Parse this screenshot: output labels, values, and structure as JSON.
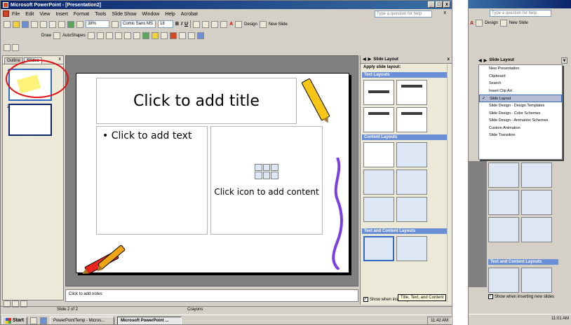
{
  "window": {
    "title": "Microsoft PowerPoint - [Presentation2]",
    "controls": [
      "_",
      "□",
      "x"
    ]
  },
  "menu": {
    "items": [
      "File",
      "Edit",
      "View",
      "Insert",
      "Format",
      "Tools",
      "Slide Show",
      "Window",
      "Help",
      "Acrobat"
    ],
    "ask_placeholder": "Type a question for help",
    "close": "x"
  },
  "toolbar1": {
    "zoom": "38%",
    "font": "Comic Sans MS",
    "size": "18",
    "bold": "B",
    "italic": "I",
    "underline": "U",
    "font_color": "A",
    "design": "Design",
    "new_slide": "New Slide"
  },
  "toolbar2": {
    "draw": "Draw",
    "autoshapes": "AutoShapes"
  },
  "slides_pane": {
    "tabs": [
      "Outline",
      "Slides"
    ],
    "close": "x",
    "thumbs": [
      "1",
      "2"
    ]
  },
  "slide": {
    "title_placeholder": "Click to add title",
    "text_placeholder": "• Click to add text",
    "content_placeholder": "Click icon to add content"
  },
  "notes": {
    "placeholder": "Click to add notes"
  },
  "status": {
    "slide": "Slide 2 of 2",
    "design": "Crayons"
  },
  "taskpane": {
    "title": "Slide Layout",
    "close": "x",
    "apply_label": "Apply slide layout:",
    "sections": [
      "Text Layouts",
      "Content Layouts",
      "Text and Content Layouts"
    ],
    "show_checkbox": "Show when inserting new slides",
    "tooltip": "Title, Text, and Content"
  },
  "taskbar": {
    "start": "Start",
    "tasks": [
      "PowerPointTemp - Micros...",
      "Microsoft PowerPoint ..."
    ],
    "clock": "11:42 AM"
  },
  "right_window": {
    "ask_placeholder": "Type a question for help",
    "design": "Design",
    "new_slide": "New Slide",
    "taskpane_title": "Slide Layout",
    "dropdown_items": [
      "New Presentation",
      "Clipboard",
      "Search",
      "Insert Clip Art",
      "Slide Layout",
      "Slide Design - Design Templates",
      "Slide Design - Color Schemes",
      "Slide Design - Animation Schemes",
      "Custom Animation",
      "Slide Transition"
    ],
    "selected_index": 4,
    "section": "Text and Content Layouts",
    "show_checkbox": "Show when inserting new slides",
    "clock": "11:01 AM"
  }
}
